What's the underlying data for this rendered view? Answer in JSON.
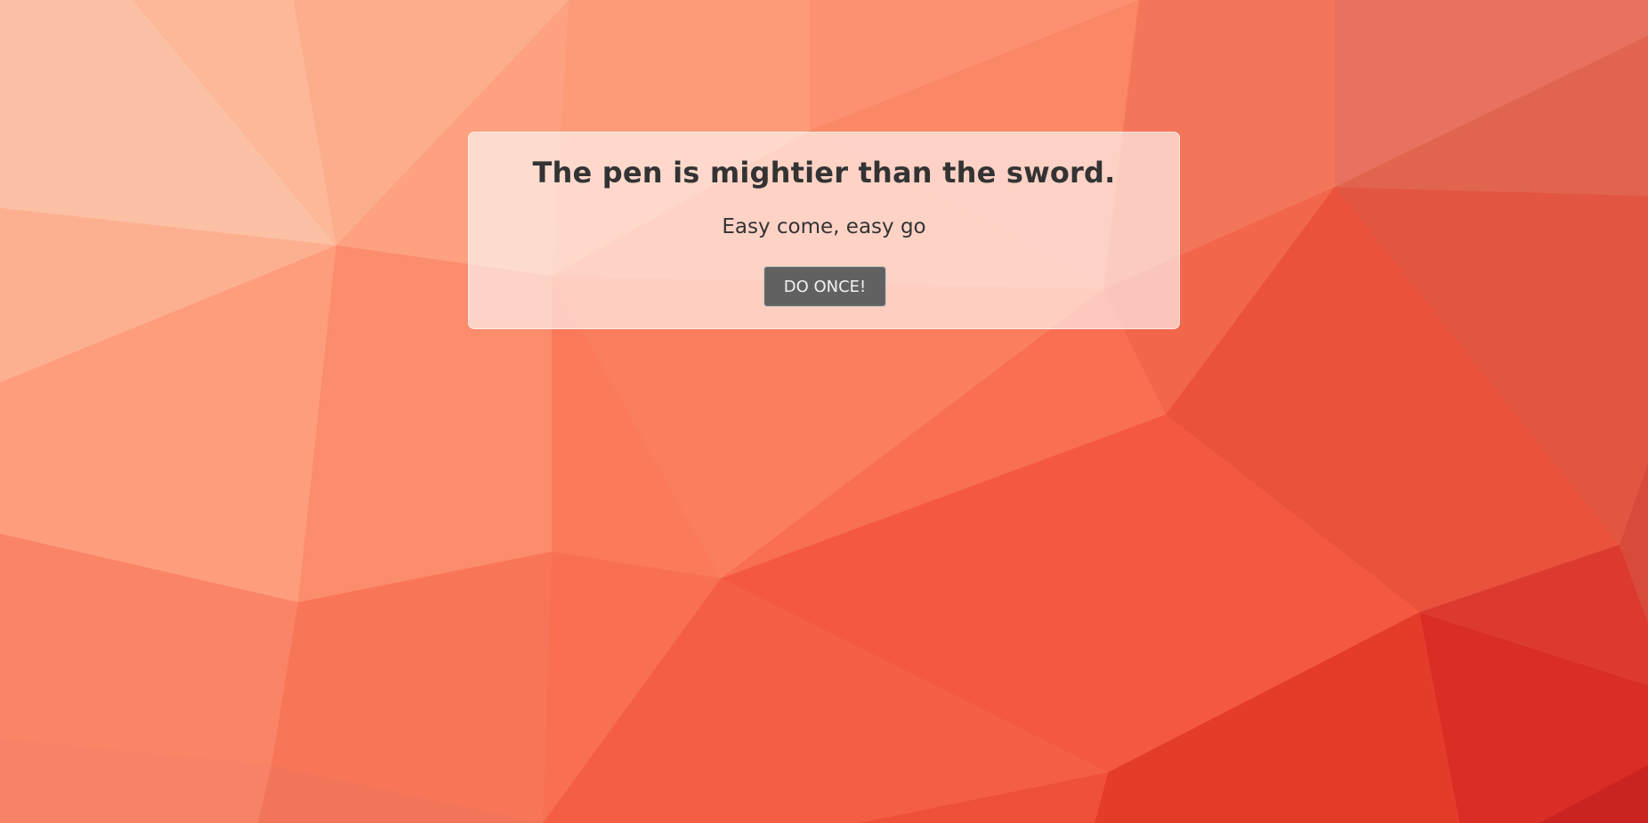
{
  "card": {
    "headline": "The pen is mightier than the sword.",
    "subline": "Easy come, easy go",
    "button_label": "DO ONCE!"
  },
  "colors": {
    "card_text": "#333333",
    "button_bg": "#616161",
    "button_text": "#f2f2f2"
  }
}
